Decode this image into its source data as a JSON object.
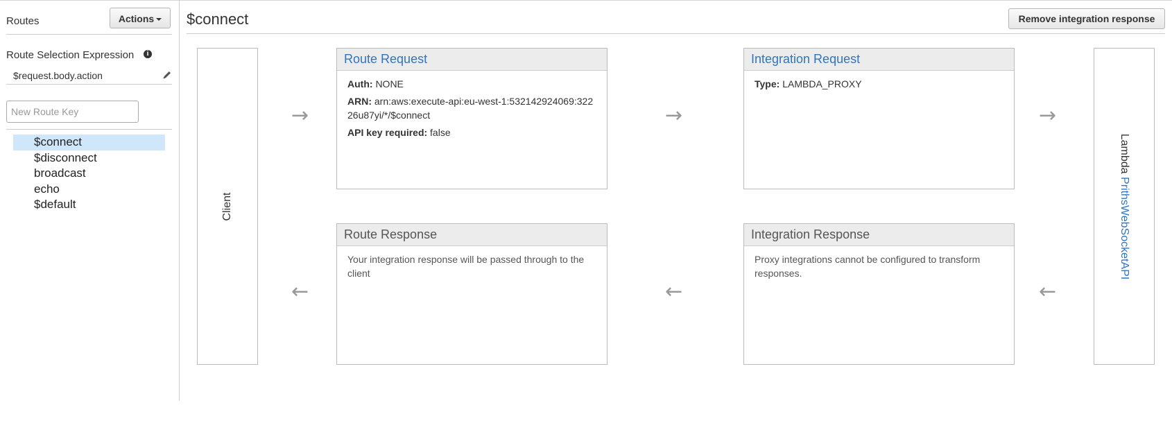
{
  "sidebar": {
    "title": "Routes",
    "actions_label": "Actions",
    "route_selection_label": "Route Selection Expression",
    "route_selection_value": "$request.body.action",
    "new_route_placeholder": "New Route Key",
    "routes": [
      {
        "label": "$connect",
        "selected": true
      },
      {
        "label": "$disconnect",
        "selected": false
      },
      {
        "label": "broadcast",
        "selected": false
      },
      {
        "label": "echo",
        "selected": false
      },
      {
        "label": "$default",
        "selected": false
      }
    ]
  },
  "header": {
    "title": "$connect",
    "remove_button": "Remove integration response"
  },
  "client": {
    "label": "Client"
  },
  "lambda": {
    "prefix": "Lambda",
    "name": "PrithsWebSocketAPI"
  },
  "route_request": {
    "title": "Route Request",
    "auth_key": "Auth:",
    "auth_value": "NONE",
    "arn_key": "ARN:",
    "arn_value": "arn:aws:execute-api:eu-west-1:532142924069:32226u87yi/*/$connect",
    "api_key_key": "API key required:",
    "api_key_value": "false"
  },
  "integration_request": {
    "title": "Integration Request",
    "type_key": "Type:",
    "type_value": "LAMBDA_PROXY"
  },
  "route_response": {
    "title": "Route Response",
    "text": "Your integration response will be passed through to the client"
  },
  "integration_response": {
    "title": "Integration Response",
    "text": "Proxy integrations cannot be configured to transform responses."
  },
  "icons": {
    "arrow_right": "→",
    "arrow_left": "←",
    "info": "i"
  },
  "colors": {
    "link": "#2f75c0",
    "selected_row": "#cfe6fb",
    "panel_header": "#ececec"
  }
}
